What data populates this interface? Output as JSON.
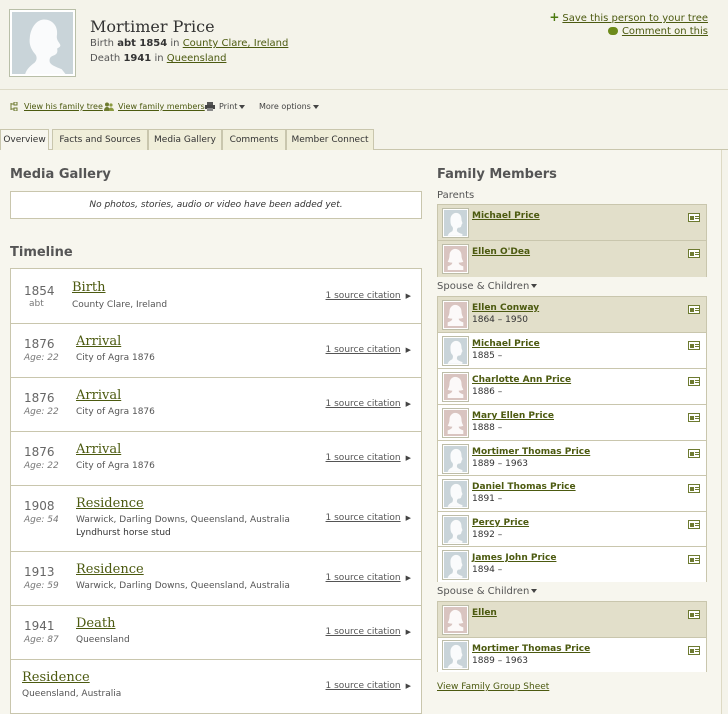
{
  "person": {
    "name": "Mortimer Price",
    "birth_label": "Birth",
    "birth_date": "abt 1854",
    "birth_in": "in",
    "birth_place": "County Clare, Ireland",
    "death_label": "Death",
    "death_date": "1941",
    "death_in": "in",
    "death_place": "Queensland"
  },
  "top_actions": {
    "save": "Save this person to your tree",
    "comment": "Comment on this"
  },
  "actions": {
    "view_tree": "View his family tree",
    "view_family": "View family members",
    "print": "Print",
    "more": "More options"
  },
  "tabs": [
    "Overview",
    "Facts and Sources",
    "Media Gallery",
    "Comments",
    "Member Connect"
  ],
  "media": {
    "heading": "Media Gallery",
    "empty": "No photos, stories, audio or video have been added yet."
  },
  "timeline": {
    "heading": "Timeline",
    "events": [
      {
        "year": "1854",
        "age": "abt",
        "type": "Birth",
        "place": "County Clare, Ireland",
        "note": "",
        "cite": "1 source citation"
      },
      {
        "year": "1876",
        "age": "Age: 22",
        "type": "Arrival",
        "place": "City of Agra 1876",
        "note": "",
        "cite": "1 source citation"
      },
      {
        "year": "1876",
        "age": "Age: 22",
        "type": "Arrival",
        "place": "City of Agra 1876",
        "note": "",
        "cite": "1 source citation"
      },
      {
        "year": "1876",
        "age": "Age: 22",
        "type": "Arrival",
        "place": "City of Agra 1876",
        "note": "",
        "cite": "1 source citation"
      },
      {
        "year": "1908",
        "age": "Age: 54",
        "type": "Residence",
        "place": "Warwick, Darling Downs, Queensland, Australia",
        "note": "Lyndhurst horse stud",
        "cite": "1 source citation"
      },
      {
        "year": "1913",
        "age": "Age: 59",
        "type": "Residence",
        "place": "Warwick, Darling Downs, Queensland, Australia",
        "note": "",
        "cite": "1 source citation"
      },
      {
        "year": "1941",
        "age": "Age: 87",
        "type": "Death",
        "place": "Queensland",
        "note": "",
        "cite": "1 source citation"
      },
      {
        "year": "",
        "age": "",
        "type": "Residence",
        "place": "Queensland, Australia",
        "note": "",
        "cite": "1 source citation"
      }
    ]
  },
  "family": {
    "heading": "Family Members",
    "parents_label": "Parents",
    "parents": [
      {
        "name": "Michael Price",
        "dates": "",
        "gender": "m"
      },
      {
        "name": "Ellen O'Dea",
        "dates": "",
        "gender": "f"
      }
    ],
    "spouse_label_1": "Spouse & Children",
    "group1": [
      {
        "name": "Ellen Conway",
        "dates": "1864 – 1950",
        "gender": "f"
      },
      {
        "name": "Michael Price",
        "dates": "1885 –",
        "gender": "m"
      },
      {
        "name": "Charlotte Ann Price",
        "dates": "1886 –",
        "gender": "f"
      },
      {
        "name": "Mary Ellen Price",
        "dates": "1888 –",
        "gender": "f"
      },
      {
        "name": "Mortimer Thomas Price",
        "dates": "1889 – 1963",
        "gender": "m"
      },
      {
        "name": "Daniel Thomas Price",
        "dates": "1891 –",
        "gender": "m"
      },
      {
        "name": "Percy Price",
        "dates": "1892 –",
        "gender": "m"
      },
      {
        "name": "James John Price",
        "dates": "1894 –",
        "gender": "m"
      }
    ],
    "spouse_label_2": "Spouse & Children",
    "group2": [
      {
        "name": "Ellen",
        "dates": "",
        "gender": "f"
      },
      {
        "name": "Mortimer Thomas Price",
        "dates": "1889 – 1963",
        "gender": "m"
      }
    ],
    "group_sheet": "View Family Group Sheet"
  }
}
